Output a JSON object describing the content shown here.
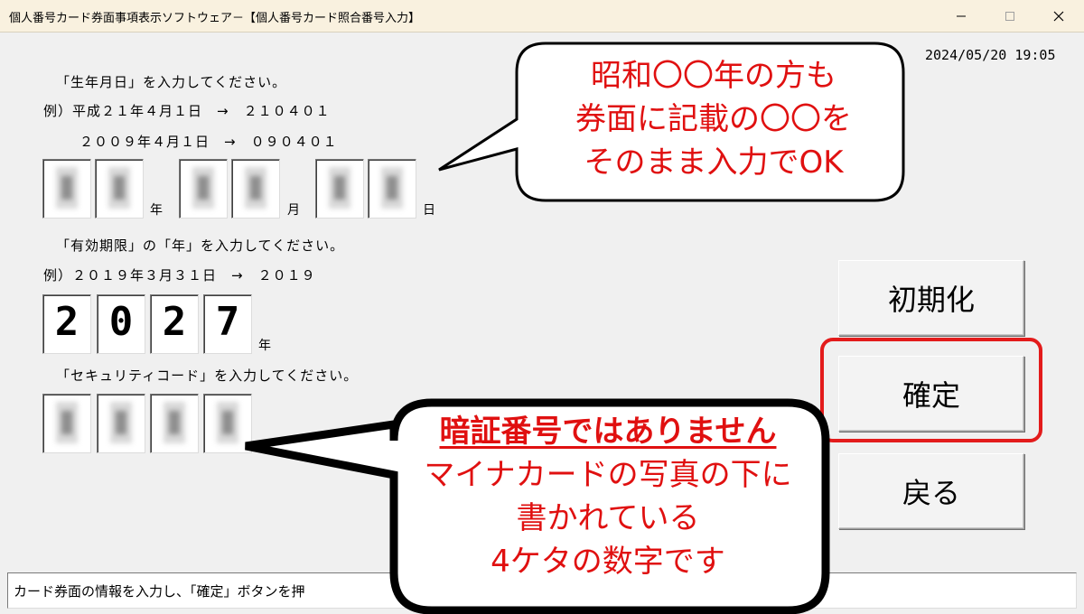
{
  "window": {
    "title": "個人番号カード券面事項表示ソフトウェア－【個人番号カード照合番号入力】",
    "datetime": "2024/05/20 19:05"
  },
  "birthdate": {
    "instruction": "「生年月日」を入力してください。",
    "example1": "例）平成２１年４月１日　→　２１０４０１",
    "example2": "２００９年４月１日　→　０９０４０１",
    "unit_year": "年",
    "unit_month": "月",
    "unit_day": "日"
  },
  "expiry": {
    "instruction": "「有効期限」の「年」を入力してください。",
    "example": "例）２０１９年３月３１日　→　２０１９",
    "digits": [
      "2",
      "0",
      "2",
      "7"
    ],
    "unit_year": "年"
  },
  "security": {
    "instruction": "「セキュリティコード」を入力してください。"
  },
  "buttons": {
    "reset": "初期化",
    "confirm": "確定",
    "back": "戻る"
  },
  "status": "カード券面の情報を入力し、「確定」ボタンを押",
  "callout_top": {
    "line1": "昭和〇〇年の方も",
    "line2": "券面に記載の〇〇を",
    "line3": "そのまま入力でOK"
  },
  "callout_bottom": {
    "line1": "暗証番号ではありません",
    "line2": "マイナカードの写真の下に",
    "line3": "書かれている",
    "line4": "4ケタの数字です"
  },
  "colors": {
    "annotation_red": "#e01010",
    "highlight_border": "#e31b1b",
    "titlebar_bg": "#f9f1df"
  }
}
